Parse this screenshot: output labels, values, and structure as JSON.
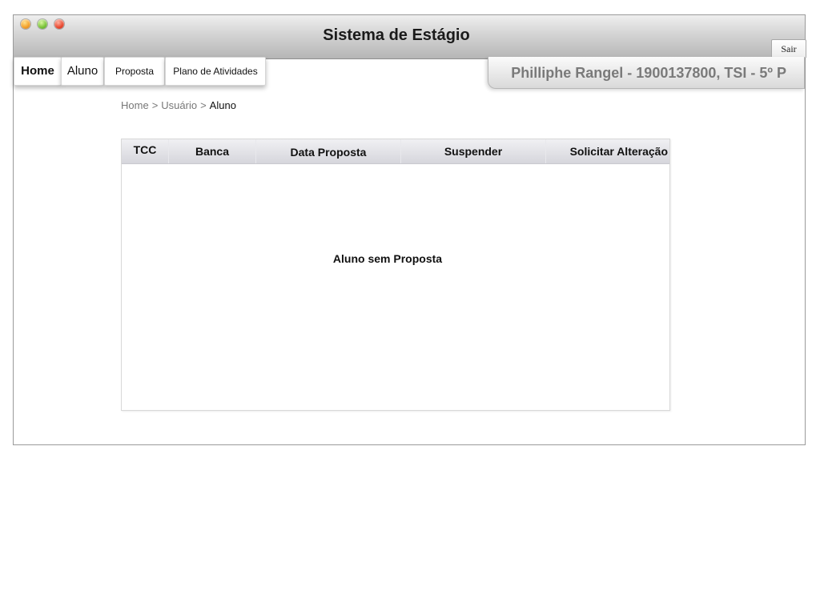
{
  "window": {
    "title": "Sistema de Estágio",
    "logout_label": "Sair"
  },
  "nav": {
    "tabs": [
      {
        "label": "Home"
      },
      {
        "label": "Aluno"
      },
      {
        "label": "Proposta"
      },
      {
        "label": "Plano de Atividades"
      }
    ]
  },
  "user": {
    "info": "Philliphe Rangel - 1900137800, TSI - 5º P"
  },
  "breadcrumb": {
    "items": [
      "Home",
      "Usuário",
      "Aluno"
    ],
    "separator": ">"
  },
  "table": {
    "columns": [
      "TCC",
      "Banca",
      "Data Proposta",
      "Suspender",
      "Solicitar Alteração"
    ],
    "empty_message": "Aluno sem Proposta"
  },
  "colors": {
    "titlebar_top": "#efefef",
    "titlebar_bottom": "#b6b6b6",
    "user_text": "#7a7a7a",
    "breadcrumb_text": "#777777",
    "table_header_bg": "#d6d6dc"
  },
  "icons": {
    "window_controls": [
      "orange-minimize-icon",
      "green-zoom-icon",
      "red-close-icon"
    ]
  }
}
